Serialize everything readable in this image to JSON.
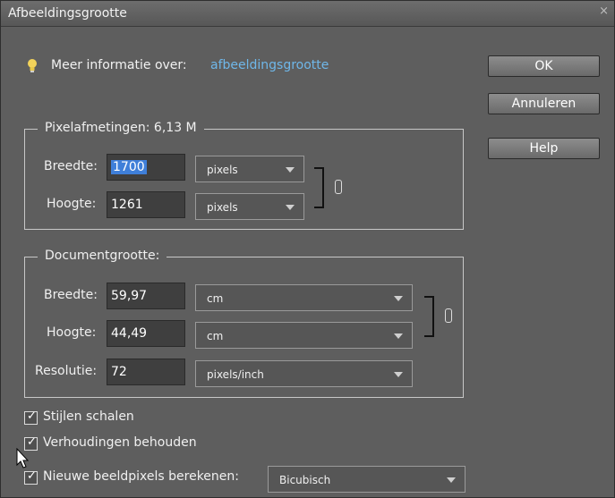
{
  "window": {
    "title": "Afbeeldingsgrootte",
    "close": "×"
  },
  "info": {
    "label": "Meer informatie over:",
    "link": "afbeeldingsgrootte"
  },
  "buttons": {
    "ok": "OK",
    "cancel": "Annuleren",
    "help": "Help"
  },
  "pixel_dims": {
    "legend": "Pixelafmetingen: 6,13 M",
    "width_label": "Breedte:",
    "width_value": "1700",
    "width_unit": "pixels",
    "height_label": "Hoogte:",
    "height_value": "1261",
    "height_unit": "pixels"
  },
  "doc_size": {
    "legend": "Documentgrootte:",
    "width_label": "Breedte:",
    "width_value": "59,97",
    "width_unit": "cm",
    "height_label": "Hoogte:",
    "height_value": "44,49",
    "height_unit": "cm",
    "res_label": "Resolutie:",
    "res_value": "72",
    "res_unit": "pixels/inch"
  },
  "options": {
    "scale_styles": {
      "label": "Stijlen schalen",
      "checked": true
    },
    "constrain": {
      "label": "Verhoudingen behouden",
      "checked": true
    },
    "resample": {
      "label": "Nieuwe beeldpixels berekenen:",
      "checked": true,
      "method": "Bicubisch"
    }
  }
}
